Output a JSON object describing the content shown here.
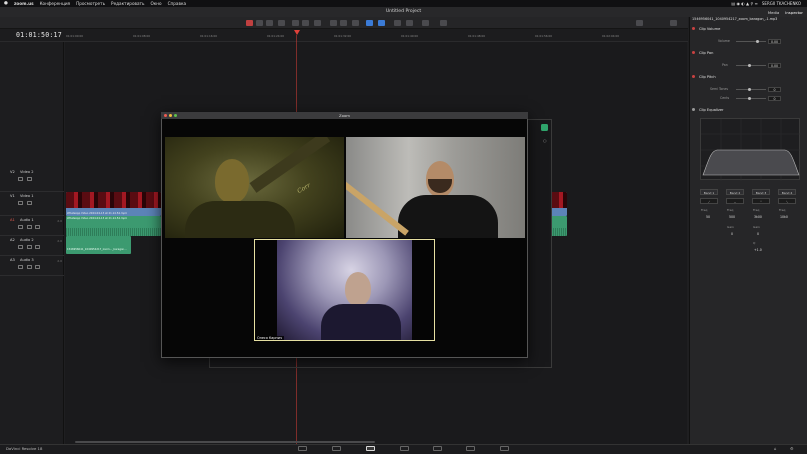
{
  "menubar": {
    "app": "zoom.us",
    "items": [
      "Конференция",
      "Просмотреть",
      "Редактировать",
      "Окно",
      "Справка"
    ],
    "user": "SERGII TKACHENKO"
  },
  "project": {
    "title": "Untitled Project"
  },
  "timeline": {
    "timecode": "01:01:50:17",
    "ruler": [
      "01:01:00:00",
      "01:01:08:00",
      "01:01:16:00",
      "01:01:24:00",
      "01:01:32:00",
      "01:01:40:00",
      "01:01:48:00",
      "01:01:56:00",
      "01:02:04:00"
    ],
    "tracks": [
      {
        "id": "V2",
        "name": "Video 2"
      },
      {
        "id": "V1",
        "name": "Video 1"
      },
      {
        "id": "A1",
        "name": "Audio 1",
        "num": "2.0"
      },
      {
        "id": "A2",
        "name": "Audio 2",
        "num": "2.0"
      },
      {
        "id": "A3",
        "name": "Audio 3",
        "num": "2.0"
      }
    ],
    "clips": {
      "v1_label": "WhatsApp Video 2024-04-13 at 21.14.54.mp4",
      "a1_label": "WhatsApp Video 2024-04-13 at 21.14.54.mp4",
      "a2_label": "1546956041_1040954217_zoom..._baragon..."
    }
  },
  "inspector": {
    "media_label": "Media",
    "tab_label": "Inspector",
    "file": "1546956041_1040954217_zoom_baragon_-1.mp3",
    "clip_volume": {
      "title": "Clip Volume",
      "volume_label": "Volume",
      "volume_value": "0.00"
    },
    "clip_pan": {
      "title": "Clip Pan",
      "pan_label": "Pan",
      "pan_value": "0.00"
    },
    "clip_pitch": {
      "title": "Clip Pitch",
      "semitones_label": "Semi Tones",
      "semitones_value": "0",
      "cents_label": "Cents",
      "cents_value": "0"
    },
    "clip_eq": {
      "title": "Clip Equalizer",
      "bands": [
        "Band 1",
        "Band 2",
        "Band 3",
        "Band 4"
      ],
      "freq_label": "Freq",
      "freq_values": [
        "50",
        "500",
        "3k00",
        "10k0"
      ],
      "gain_label": "Gain",
      "gain_values": [
        "0",
        "0"
      ],
      "q_label": "Q",
      "q_value": "+1.0"
    }
  },
  "zoom": {
    "window_title": "Zoom",
    "participant_name": "Олеся Карпич",
    "guitar_brand": "Corr"
  },
  "bottom": {
    "brand": "DaVinci Resolve 18"
  }
}
